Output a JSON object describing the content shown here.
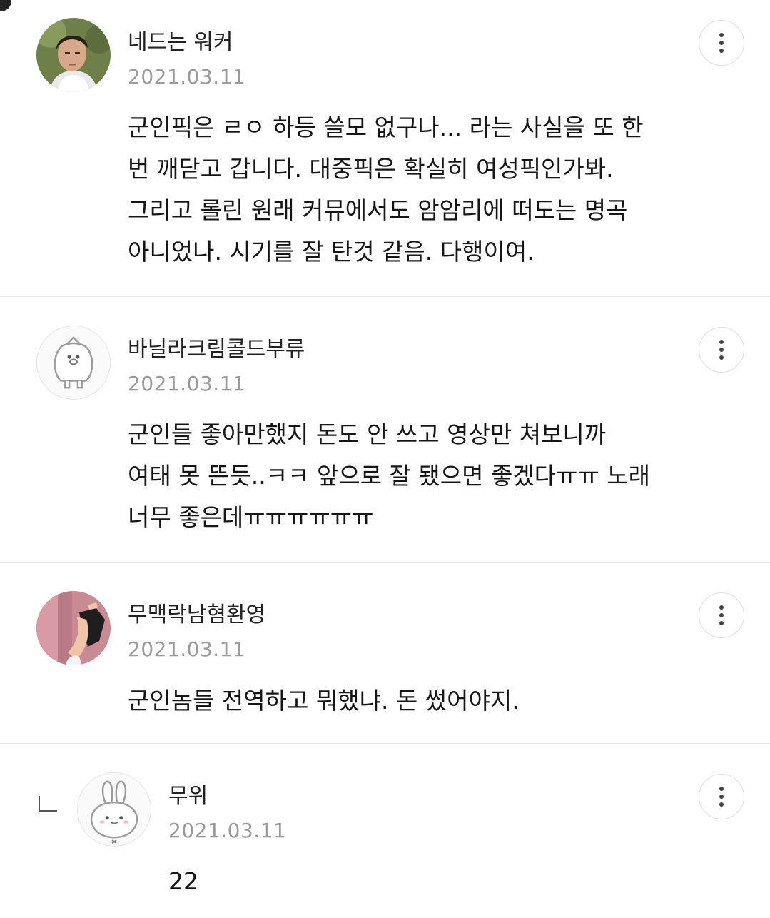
{
  "comments": [
    {
      "nickname": "네드는 워커",
      "date": "2021.03.11",
      "text": "군인픽은 ㄹㅇ 하등 쓸모 없구나... 라는 사실을 또 한\n번 깨닫고 갑니다. 대중픽은 확실히 여성픽인가봐.\n그리고 롤린 원래 커뮤에서도 암암리에 떠도는 명곡\n아니었나. 시기를 잘 탄것 같음. 다행이여.",
      "avatar": "person-photo-icon"
    },
    {
      "nickname": "바닐라크림콜드부류",
      "date": "2021.03.11",
      "text": "군인들 좋아만했지 돈도 안 쓰고 영상만 쳐보니까\n여태 못 뜬듯..ㅋㅋ 앞으로 잘 됐으면 좋겠다ㅠㅠ 노래\n너무 좋은데ㅠㅠㅠㅠㅠㅠ",
      "avatar": "penguin-icon"
    },
    {
      "nickname": "무맥락남혐환영",
      "date": "2021.03.11",
      "text": "군인놈들 전역하고 뭐했냐. 돈 썼어야지.",
      "avatar": "drawing-photo-icon"
    }
  ],
  "reply": {
    "nickname": "무위",
    "date": "2021.03.11",
    "text": "22",
    "avatar": "bunny-icon",
    "reply_marker": "reply-arrow-icon"
  },
  "more_icon": "more-vertical-icon"
}
